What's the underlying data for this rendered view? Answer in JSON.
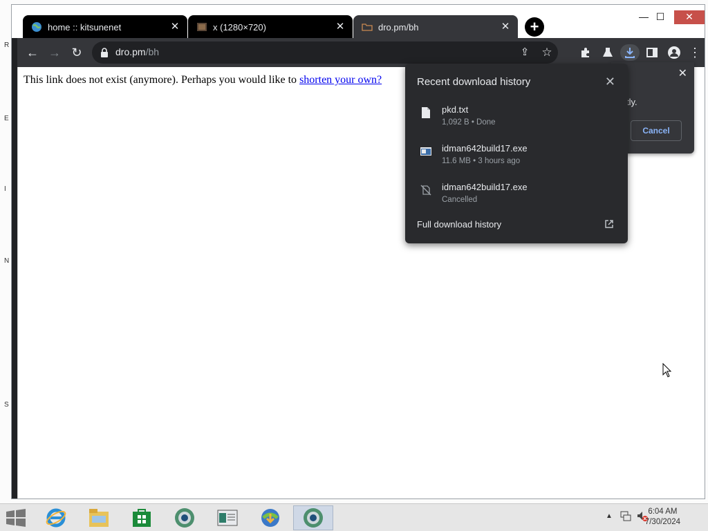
{
  "browser": {
    "tabs": [
      {
        "title": "home :: kitsunenet",
        "favicon": "globe-icon",
        "active": false
      },
      {
        "title": "x (1280×720)",
        "favicon": "image-icon",
        "active": false
      },
      {
        "title": "dro.pm/bh",
        "favicon": "folder-icon",
        "active": true
      }
    ],
    "url_host": "dro.pm",
    "url_path": "/bh"
  },
  "page": {
    "message": "This link does not exist (anymore). Perhaps you would like to",
    "link": "shorten your own?"
  },
  "background_dialog": {
    "text_fragment": "tly.",
    "cancel_label": "Cancel"
  },
  "downloads": {
    "title": "Recent download history",
    "items": [
      {
        "name": "pkd.txt",
        "status": "1,092 B • Done",
        "icon": "text-file-icon"
      },
      {
        "name": "idman642build17.exe",
        "status": "11.6 MB • 3 hours ago",
        "icon": "exe-file-icon"
      },
      {
        "name": "idman642build17.exe",
        "status": "Cancelled",
        "icon": "cancelled-file-icon"
      }
    ],
    "full_history": "Full download history"
  },
  "taskbar": {
    "time": "6:04 AM",
    "date": "7/30/2024"
  },
  "desktop_marks": [
    "R",
    "E",
    "I",
    "N",
    "S"
  ]
}
